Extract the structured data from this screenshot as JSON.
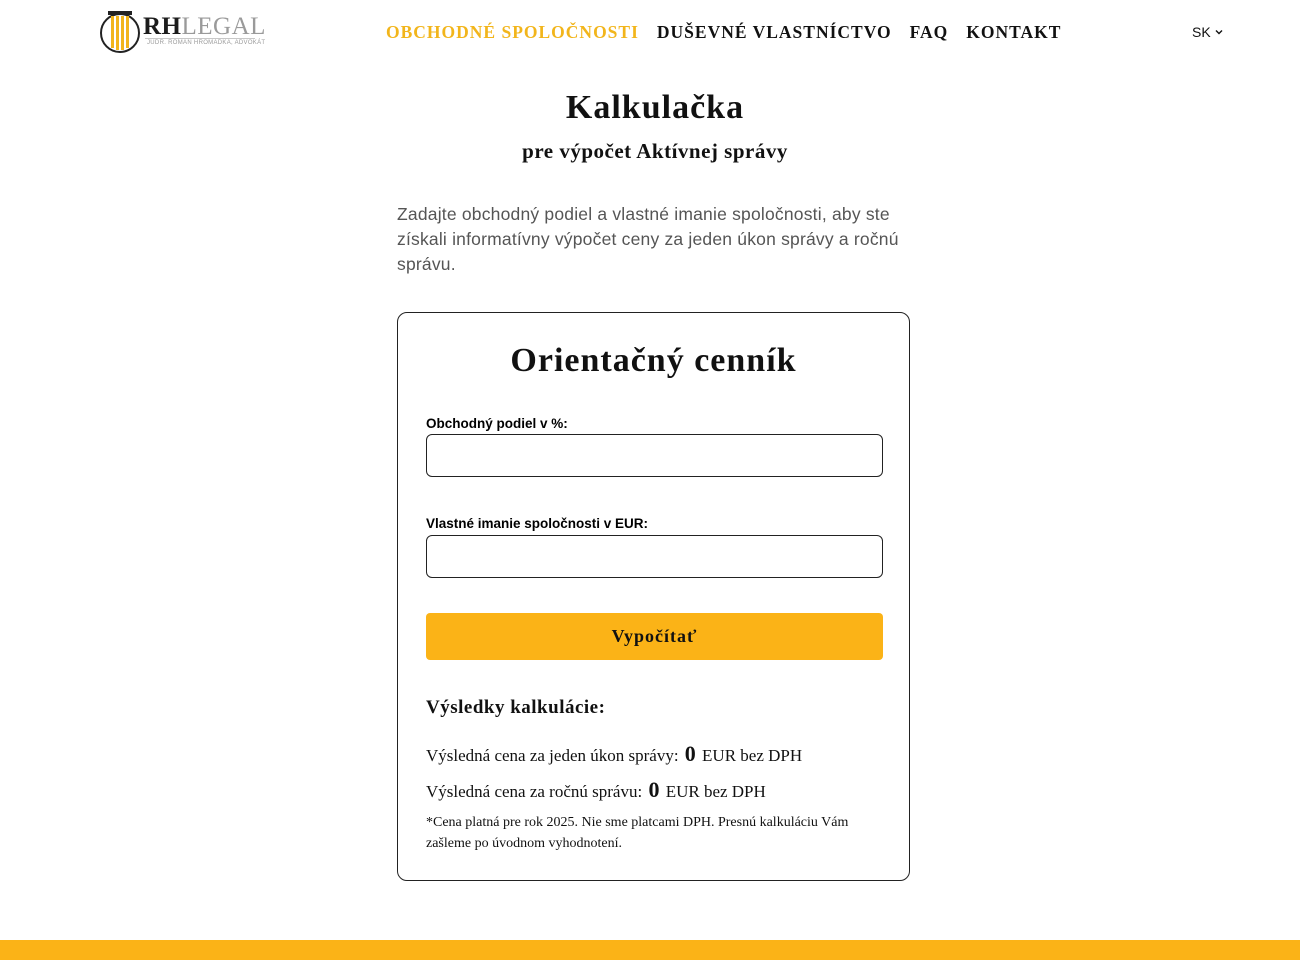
{
  "header": {
    "logo": {
      "brand_bold": "RH",
      "brand_light": "LEGAL",
      "tagline": "JUDR. ROMAN HROMADKA, ADVOKÁT"
    },
    "nav": [
      {
        "label": "OBCHODNÉ SPOLOČNOSTI",
        "active": true
      },
      {
        "label": "DUŠEVNÉ VLASTNÍCTVO",
        "active": false
      },
      {
        "label": "FAQ",
        "active": false
      },
      {
        "label": "KONTAKT",
        "active": false
      }
    ],
    "language": "SK"
  },
  "main": {
    "title": "Kalkulačka",
    "subtitle": "pre výpočet Aktívnej správy",
    "intro": "Zadajte obchodný podiel a vlastné imanie spoločnosti, aby ste získali informatívny výpočet ceny za jeden úkon správy a ročnú správu."
  },
  "calculator": {
    "title": "Orientačný cenník",
    "share_label": "Obchodný podiel v %:",
    "share_value": "",
    "equity_label": "Vlastné imanie spoločnosti v EUR:",
    "equity_value": "",
    "button_label": "Vypočítať",
    "results_title": "Výsledky kalkulácie:",
    "single_prefix": "Výsledná cena za jeden úkon správy:",
    "single_value": "0",
    "single_suffix": "EUR bez DPH",
    "annual_prefix": "Výsledná cena za ročnú správu:",
    "annual_value": "0",
    "annual_suffix": "EUR bez DPH",
    "note": "*Cena platná pre rok 2025. Nie sme platcami DPH. Presnú kalkuláciu Vám zašleme po úvodnom vyhodnotení."
  },
  "colors": {
    "accent": "#fbb317",
    "nav_active": "#f2b51b",
    "text": "#111111",
    "muted": "#555555"
  }
}
